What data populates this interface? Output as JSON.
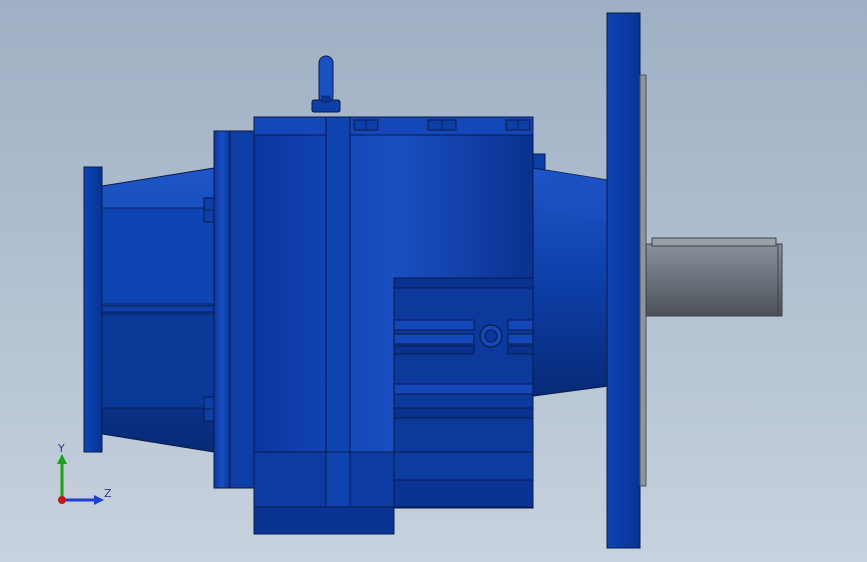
{
  "view": {
    "model_colors": {
      "housing": "#0b3a9e",
      "housing_dark": "#082a78",
      "housing_light": "#1e56c8",
      "shaft": "#6f757e",
      "edge": "#0a1a4a"
    },
    "background_top": "#9fb0c4",
    "background_bottom": "#c7d2de"
  },
  "triad": {
    "y_label": "Y",
    "z_label": "Z",
    "y_color": "#1aa21a",
    "z_color": "#1f3fd0",
    "x_color": "#c01818"
  }
}
